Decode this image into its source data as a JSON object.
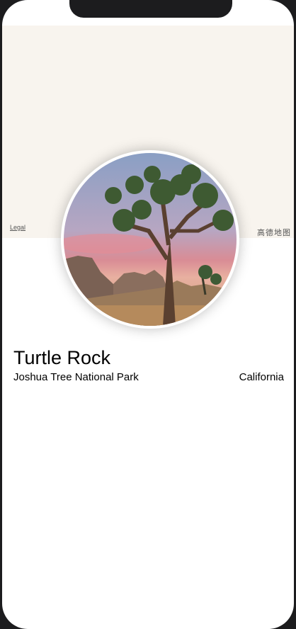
{
  "map": {
    "legal_label": "Legal",
    "brand_label": "高德地图"
  },
  "landmark": {
    "name": "Turtle Rock",
    "park": "Joshua Tree National Park",
    "state": "California",
    "image_icon": "joshua-tree-photo"
  }
}
